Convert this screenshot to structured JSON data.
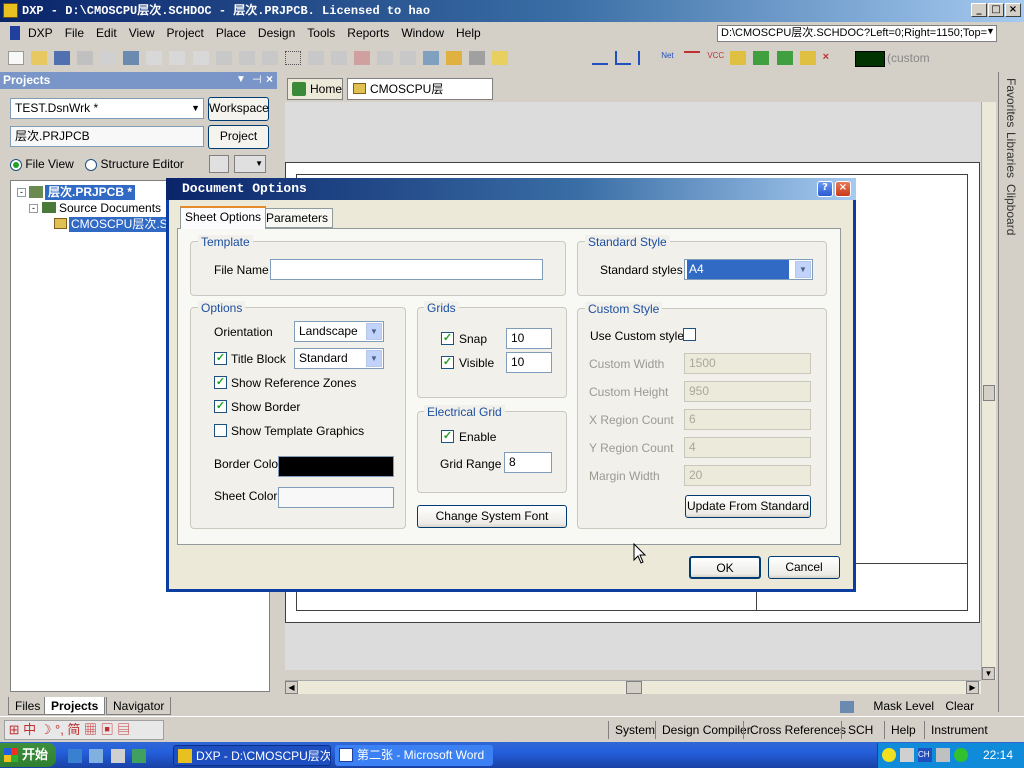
{
  "window": {
    "title": "DXP - D:\\CMOSCPU层次.SCHDOC - 层次.PRJPCB. Licensed to hao"
  },
  "menubar": {
    "items": [
      "DXP",
      "File",
      "Edit",
      "View",
      "Project",
      "Place",
      "Design",
      "Tools",
      "Reports",
      "Window",
      "Help"
    ],
    "path": "D:\\CMOSCPU层次.SCHDOC?Left=0;Right=1150;Top="
  },
  "toolbar": {
    "custom_label": "(custom"
  },
  "projects_panel": {
    "title": "Projects",
    "workspace_value": "TEST.DsnWrk *",
    "workspace_button": "Workspace",
    "project_value": "层次.PRJPCB",
    "project_button": "Project",
    "file_view": "File View",
    "structure_editor": "Structure Editor",
    "tree": {
      "root": "层次.PRJPCB *",
      "folder": "Source Documents",
      "doc": "CMOSCPU层次.SC"
    },
    "tabs": [
      "Files",
      "Projects",
      "Navigator"
    ]
  },
  "doc_tabs": {
    "home": "Home",
    "doc": "CMOSCPU层次.SCHDOC"
  },
  "right_dock": [
    "Favorites",
    "Libraries",
    "Clipboard"
  ],
  "dialog": {
    "title": "Document Options",
    "tabs": [
      "Sheet Options",
      "Parameters"
    ],
    "template": {
      "group": "Template",
      "file_name_label": "File Name",
      "file_name_value": ""
    },
    "standard_style": {
      "group": "Standard Style",
      "label": "Standard styles",
      "value": "A4"
    },
    "options": {
      "group": "Options",
      "orientation_label": "Orientation",
      "orientation_value": "Landscape",
      "title_block_label": "Title Block",
      "title_block_value": "Standard",
      "title_block_checked": true,
      "show_reference_zones": "Show Reference Zones",
      "show_reference_zones_checked": true,
      "show_border": "Show Border",
      "show_border_checked": true,
      "show_template_graphics": "Show Template Graphics",
      "show_template_graphics_checked": false,
      "border_color_label": "Border Color",
      "border_color": "#000000",
      "sheet_color_label": "Sheet Color",
      "sheet_color": "#f8f8f8"
    },
    "grids": {
      "group": "Grids",
      "snap_label": "Snap",
      "snap_value": "10",
      "snap_checked": true,
      "visible_label": "Visible",
      "visible_value": "10",
      "visible_checked": true
    },
    "electrical_grid": {
      "group": "Electrical Grid",
      "enable_label": "Enable",
      "enable_checked": true,
      "grid_range_label": "Grid Range",
      "grid_range_value": "8"
    },
    "change_font_button": "Change System Font",
    "custom_style": {
      "group": "Custom Style",
      "use_label": "Use Custom style",
      "use_checked": false,
      "width_label": "Custom Width",
      "width_value": "1500",
      "height_label": "Custom Height",
      "height_value": "950",
      "xregion_label": "X Region Count",
      "xregion_value": "6",
      "yregion_label": "Y Region Count",
      "yregion_value": "4",
      "margin_label": "Margin Width",
      "margin_value": "20",
      "update_button": "Update From Standard"
    },
    "ok_button": "OK",
    "cancel_button": "Cancel"
  },
  "statusbar": {
    "mask_level": "Mask Level",
    "clear": "Clear",
    "items": [
      "System",
      "Design Compiler",
      "Cross References",
      "SCH",
      "Help",
      "Instrument Racks"
    ]
  },
  "taskbar": {
    "start": "开始",
    "tasks": [
      "DXP - D:\\CMOSCPU层次....",
      "第二张 - Microsoft Word"
    ],
    "clock": "22:14"
  },
  "colors": {
    "title_blue": "#0a246a",
    "selection_blue": "#316ac5",
    "checkmark_green": "#21a121"
  }
}
